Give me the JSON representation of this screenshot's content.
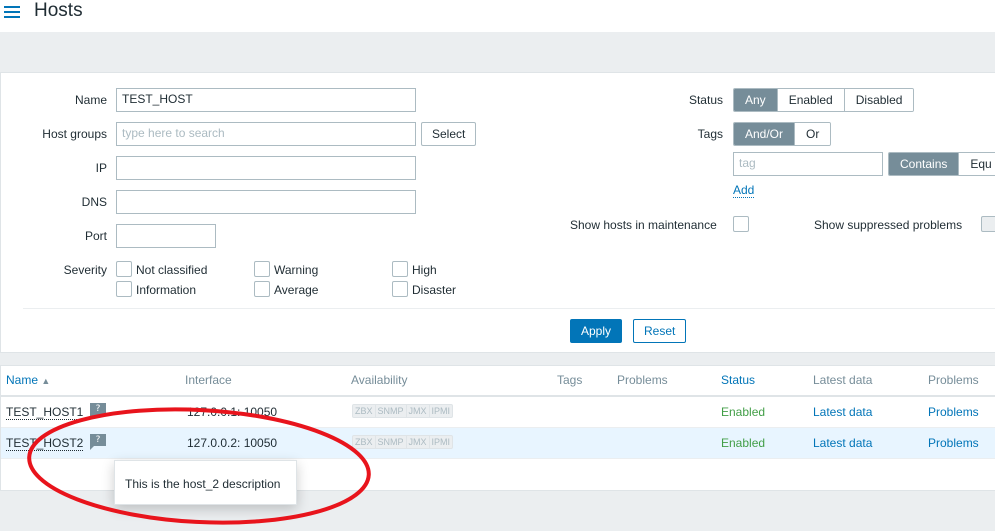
{
  "header": {
    "title": "Hosts",
    "menu_icon": "hamburger-icon"
  },
  "filter": {
    "name_label": "Name",
    "name_value": "TEST_HOST",
    "hostgroups_label": "Host groups",
    "hostgroups_placeholder": "type here to search",
    "select_label": "Select",
    "ip_label": "IP",
    "dns_label": "DNS",
    "port_label": "Port",
    "severity_label": "Severity",
    "severities": [
      "Not classified",
      "Warning",
      "High",
      "Information",
      "Average",
      "Disaster"
    ],
    "status_label": "Status",
    "status_options": [
      "Any",
      "Enabled",
      "Disabled"
    ],
    "status_selected": "Any",
    "tags_label": "Tags",
    "tags_options": [
      "And/Or",
      "Or"
    ],
    "tags_selected": "And/Or",
    "tag_placeholder": "tag",
    "tag_operators": [
      "Contains",
      "Equ"
    ],
    "tag_operator_selected": "Contains",
    "add_label": "Add",
    "maintenance_label": "Show hosts in maintenance",
    "suppressed_label": "Show suppressed problems",
    "apply_label": "Apply",
    "reset_label": "Reset"
  },
  "table": {
    "headers": {
      "name": "Name",
      "interface": "Interface",
      "availability": "Availability",
      "tags": "Tags",
      "problems": "Problems",
      "status": "Status",
      "latest": "Latest data",
      "problems2": "Problems"
    },
    "rows": [
      {
        "name": "TEST_HOST1",
        "interface": "127.0.0.1: 10050",
        "avail": [
          "ZBX",
          "SNMP",
          "JMX",
          "IPMI"
        ],
        "status": "Enabled",
        "latest": "Latest data",
        "problems": "Problems"
      },
      {
        "name": "TEST_HOST2",
        "interface": "127.0.0.2: 10050",
        "avail": [
          "ZBX",
          "SNMP",
          "JMX",
          "IPMI"
        ],
        "status": "Enabled",
        "latest": "Latest data",
        "problems": "Problems"
      }
    ],
    "hint_symbol": "?"
  },
  "tooltip": {
    "text": "This is the host_2 description"
  },
  "colors": {
    "accent": "#0275b8",
    "enabled": "#429e47",
    "annotation": "#e8141c"
  }
}
